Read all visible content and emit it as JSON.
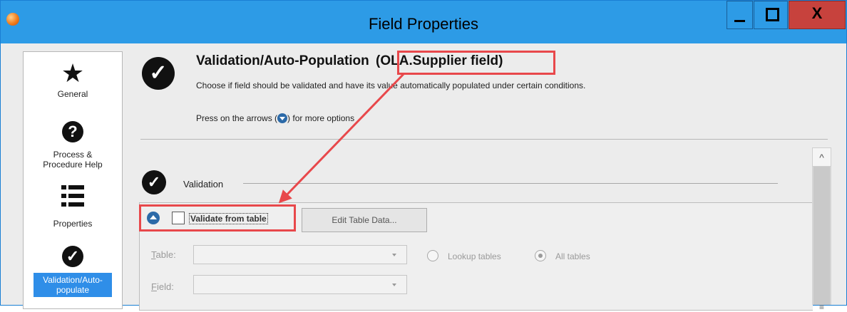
{
  "window": {
    "title": "Field Properties",
    "close_glyph": "X"
  },
  "sidebar": {
    "items": [
      {
        "label": "General",
        "icon": "star-icon"
      },
      {
        "label": "Process & Procedure Help",
        "icon": "question-icon"
      },
      {
        "label": "Properties",
        "icon": "list-icon"
      },
      {
        "label": "Validation/Auto-populate",
        "icon": "check-icon",
        "active": true
      }
    ],
    "help_line1": "Process &",
    "help_line2": "Procedure Help",
    "valid_line1": "Validation/Auto-",
    "valid_line2": "populate"
  },
  "header": {
    "title_main": "Validation/Auto-Population",
    "title_field": "(OLA.Supplier field)",
    "description": "Choose if field should be validated and have its value automatically populated under certain conditions.",
    "hint_before": "Press on the arrows (",
    "hint_after": ") for more options"
  },
  "validation": {
    "section_label": "Validation",
    "checkbox_label": "Validate from table",
    "checkbox_checked": false,
    "edit_button": "Edit Table Data...",
    "table_label_first": "T",
    "table_label_rest": "able:",
    "field_label_first": "F",
    "field_label_rest": "ield:",
    "table_value": "",
    "field_value": "",
    "radio_lookup": "Lookup tables",
    "radio_all": "All tables",
    "selected_radio": "All tables"
  },
  "colors": {
    "titlebar": "#2d9be6",
    "close": "#c7423d",
    "highlight": "#e8484b",
    "active_item": "#2f8ee8"
  }
}
